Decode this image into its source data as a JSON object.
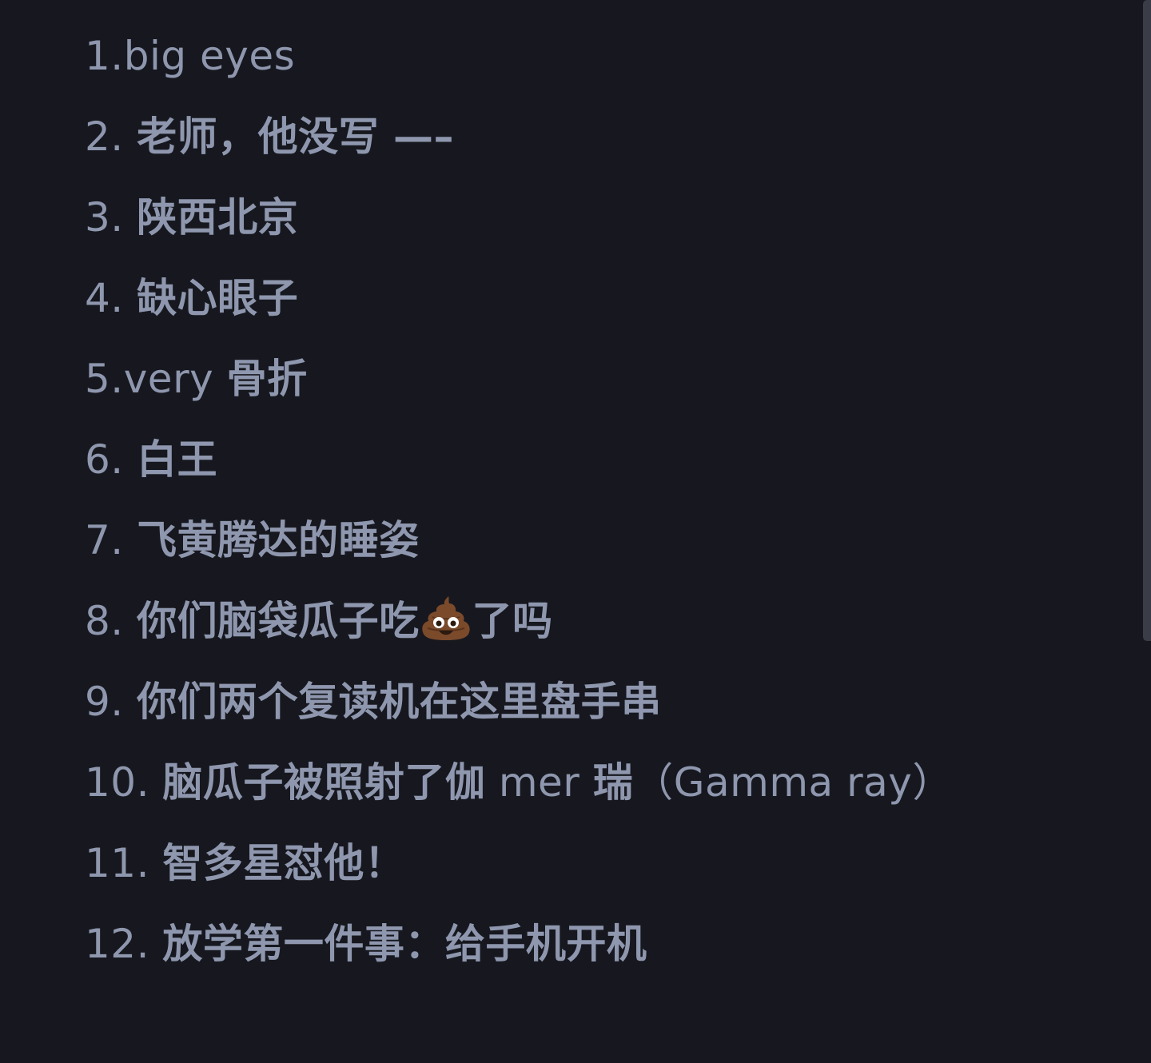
{
  "items": [
    {
      "number": "1.",
      "text": "big eyes"
    },
    {
      "number": "2. ",
      "text": "老师，他没写 —–"
    },
    {
      "number": "3. ",
      "text": "陕西北京"
    },
    {
      "number": "4. ",
      "text": "缺心眼子"
    },
    {
      "number": "5.",
      "text_a": "very ",
      "text_b": "骨折"
    },
    {
      "number": "6. ",
      "text": "白王"
    },
    {
      "number": "7. ",
      "text": "飞黄腾达的睡姿"
    },
    {
      "number": "8. ",
      "text_a": "你们脑袋瓜子吃",
      "icon": "pile-of-poo-icon",
      "text_b": "了吗"
    },
    {
      "number": "9. ",
      "text": "你们两个复读机在这里盘手串"
    },
    {
      "number": "10. ",
      "text_a": "脑瓜子被照射了伽",
      "text_b": " mer ",
      "text_c": "瑞",
      "text_d": "（Gamma ray）"
    },
    {
      "number": "11. ",
      "text": "智多星怼他！"
    },
    {
      "number": "12. ",
      "text": "放学第一件事：给手机开机"
    }
  ]
}
